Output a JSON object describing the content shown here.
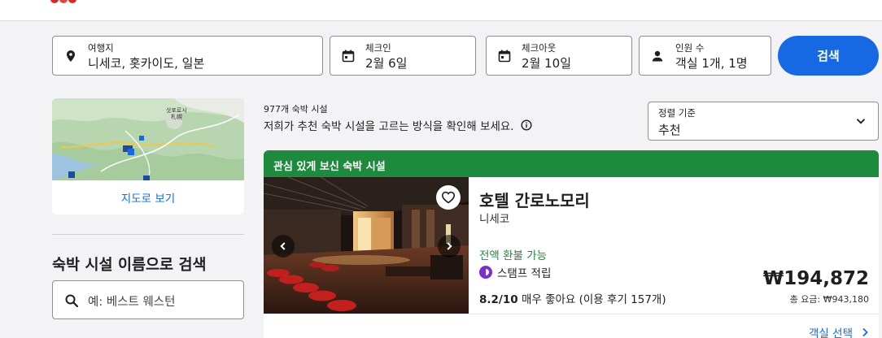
{
  "search": {
    "destination": {
      "label": "여행지",
      "value": "니세코, 홋카이도, 일본"
    },
    "checkin": {
      "label": "체크인",
      "value": "2월 6일"
    },
    "checkout": {
      "label": "체크아웃",
      "value": "2월 10일"
    },
    "guests": {
      "label": "인원 수",
      "value": "객실 1개, 1명"
    },
    "button_label": "검색"
  },
  "sidebar": {
    "map_link": "지도로 보기",
    "map_labels": [
      "삿포로시",
      "札幌"
    ],
    "name_search_title": "숙박 시설 이름으로 검색",
    "name_search_placeholder": "예: 베스트 웨스턴"
  },
  "results": {
    "count": "977개 숙박 시설",
    "how_recommended": "저희가 추천 숙박 시설을 고르는 방식을 확인해 보세요.",
    "sort": {
      "label": "정렬 기준",
      "value": "추천"
    }
  },
  "listing": {
    "banner": "관심 있게 보신 숙박 시설",
    "name": "호텔 간로노모리",
    "city": "니세코",
    "refund": "전액 환불 가능",
    "stamp": "스탬프 적립",
    "rating_score": "8.2/10",
    "rating_text": "매우 좋아요 (이용 후기 157개)",
    "price": "₩194,872",
    "total_price": "총 요금: ₩943,180",
    "select_room": "객실 선택"
  },
  "colors": {
    "primary": "#1668e3",
    "banner_green": "#1e8a3e",
    "refund_green": "#1e8a3e",
    "stamp_purple": "#7a2fd0"
  }
}
